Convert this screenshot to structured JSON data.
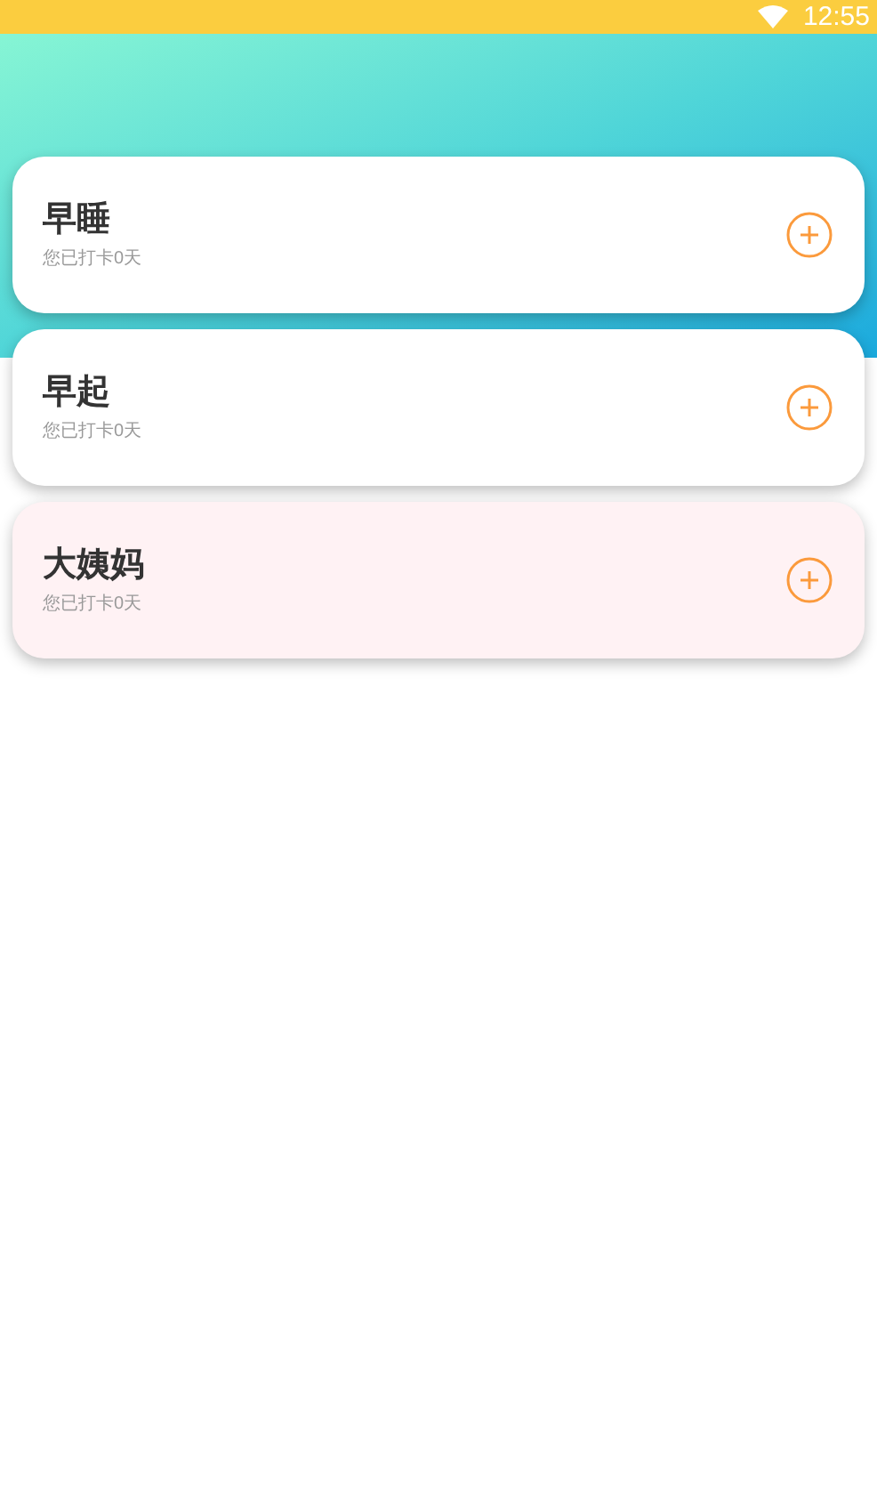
{
  "status_bar": {
    "time": "12:55"
  },
  "cards": [
    {
      "title": "早睡",
      "subtitle": "您已打卡0天",
      "color": "#ffffff"
    },
    {
      "title": "早起",
      "subtitle": "您已打卡0天",
      "color": "#ffffff"
    },
    {
      "title": "大姨妈",
      "subtitle": "您已打卡0天",
      "color": "#fff2f4"
    }
  ]
}
